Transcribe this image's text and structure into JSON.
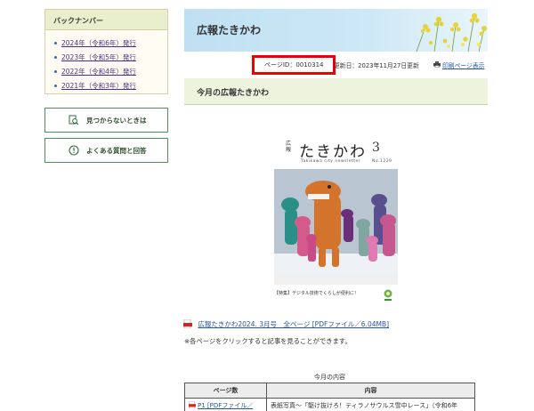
{
  "sidebar": {
    "backnumber_title": "バックナンバー",
    "backnumber_items": [
      "2024年（令和6年）発行",
      "2023年（令和5年）発行",
      "2022年（令和4年）発行",
      "2021年（令和3年）発行"
    ],
    "buttons": [
      {
        "label": "見つからないときは",
        "icon": "search-page-icon"
      },
      {
        "label": "よくある質問と回答",
        "icon": "info-circle-icon"
      }
    ]
  },
  "header": {
    "title": "広報たきかわ",
    "page_id": "ページID：0010314",
    "updated": "更新日：2023年11月27日更新",
    "print": "印刷ページ表示"
  },
  "section": {
    "title": "今月の広報たきかわ"
  },
  "cover": {
    "label_small": "広報",
    "title": "たきかわ",
    "issue_num": "3",
    "subtitle": "Takikawa city newsletter",
    "issue_no": "No.1239",
    "bottom_caption": "【特集】デジタル技術でくらしが便利に！"
  },
  "pdf": {
    "link": "広報たきかわ2024. 3月号　全ページ [PDFファイル／6.04MB]"
  },
  "note": "※各ページをクリックすると記事を見ることができます。",
  "table": {
    "caption": "今月の内容",
    "headers": [
      "ページ数",
      "内容"
    ],
    "rows": [
      [
        "P1 [PDFファイル／",
        "表紙写真～「駆け抜けろ！ティラノサウルス雪中レース」（令和6年"
      ]
    ]
  },
  "colors": {
    "accent_green": "#4f9058",
    "link_blue": "#2855a4",
    "highlight_red": "#ee0000"
  }
}
